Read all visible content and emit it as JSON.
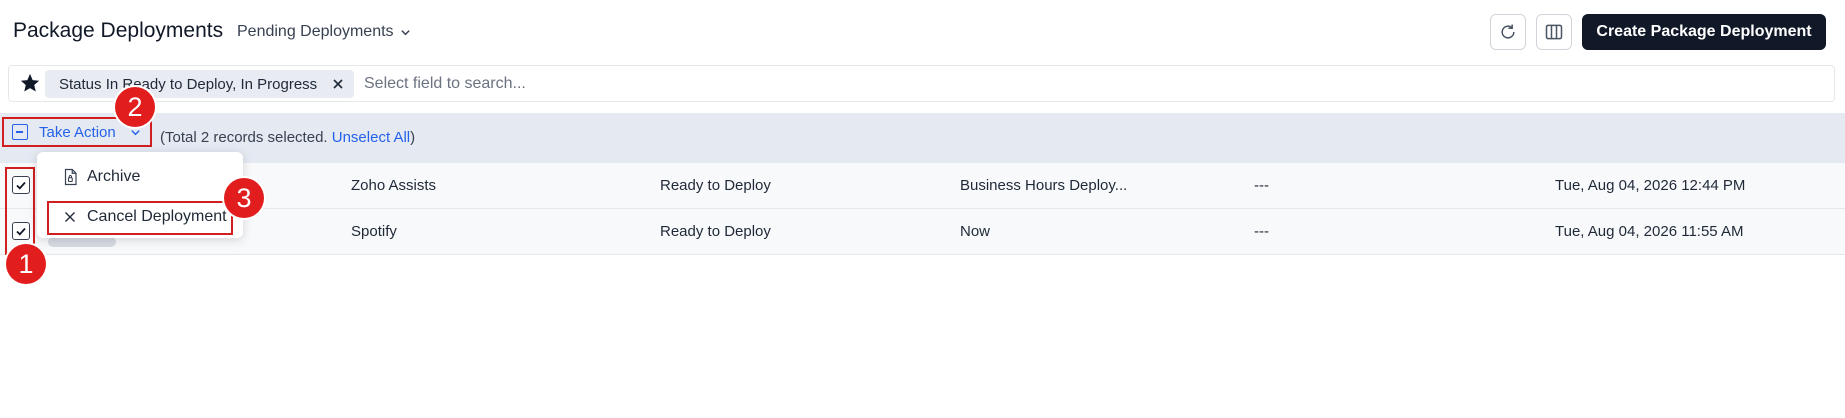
{
  "header": {
    "title": "Package Deployments",
    "view_label": "Pending Deployments",
    "create_label": "Create Package Deployment"
  },
  "search": {
    "filter_chip": "Status In Ready to Deploy, In Progress",
    "placeholder": "Select field to search..."
  },
  "action_bar": {
    "take_action_label": "Take Action",
    "info_prefix": "(Total 2 records selected.",
    "unselect_label": "Unselect All",
    "info_suffix": ")"
  },
  "menu": {
    "items": [
      {
        "label": "Archive",
        "icon": "file-lock-icon"
      },
      {
        "label": "Cancel Deployment",
        "icon": "close-icon"
      }
    ]
  },
  "rows": [
    {
      "name": "Zoho Assists",
      "status": "Ready to Deploy",
      "schedule": "Business Hours Deploy...",
      "extra": "---",
      "date": "Tue, Aug 04, 2026 12:44 PM",
      "checked": true
    },
    {
      "name": "Spotify",
      "status": "Ready to Deploy",
      "schedule": "Now",
      "extra": "---",
      "date": "Tue, Aug 04, 2026 11:55 AM",
      "checked": true
    }
  ],
  "badges": [
    "1",
    "2",
    "3"
  ],
  "colors": {
    "accent": "#2563eb",
    "annotation": "#e11d1d",
    "primary_button": "#111827"
  }
}
